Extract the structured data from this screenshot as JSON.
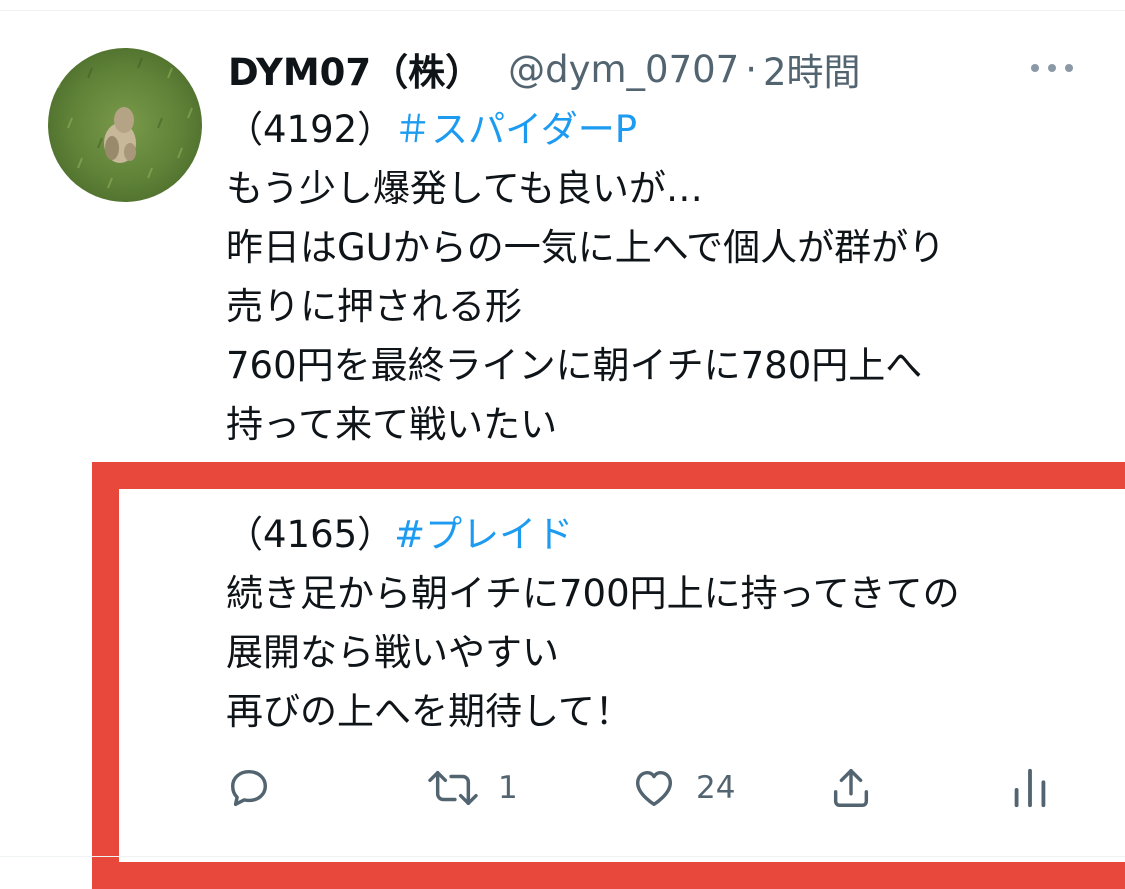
{
  "tweet": {
    "display_name": "DYM07（株）",
    "handle": "@dym_0707",
    "separator": "·",
    "time": "2時間",
    "lines": [
      {
        "plain": "（4192）",
        "hashtag": "＃スパイダーP"
      },
      {
        "plain": "もう少し爆発しても良いが…"
      },
      {
        "plain": "昨日はGUからの一気に上へで個人が群がり"
      },
      {
        "plain": "売りに押される形"
      },
      {
        "plain": "760円を最終ラインに朝イチに780円上へ"
      },
      {
        "plain": "持って来て戦いたい"
      }
    ],
    "highlighted_lines": [
      {
        "plain": "（4165）",
        "hashtag": "#プレイド"
      },
      {
        "plain": "続き足から朝イチに700円上に持ってきての"
      },
      {
        "plain": "展開なら戦いやすい"
      },
      {
        "plain": "再びの上へを期待して！"
      }
    ],
    "actions": {
      "reply": {
        "icon": "reply-icon",
        "count": ""
      },
      "retweet": {
        "icon": "retweet-icon",
        "count": "1"
      },
      "like": {
        "icon": "heart-icon",
        "count": "24"
      },
      "share": {
        "icon": "share-icon",
        "count": ""
      },
      "analytics": {
        "icon": "analytics-icon",
        "count": ""
      }
    }
  },
  "colors": {
    "text": "#0f1419",
    "secondary": "#536471",
    "link": "#1d9bf0",
    "highlight_border": "#e8473b"
  }
}
